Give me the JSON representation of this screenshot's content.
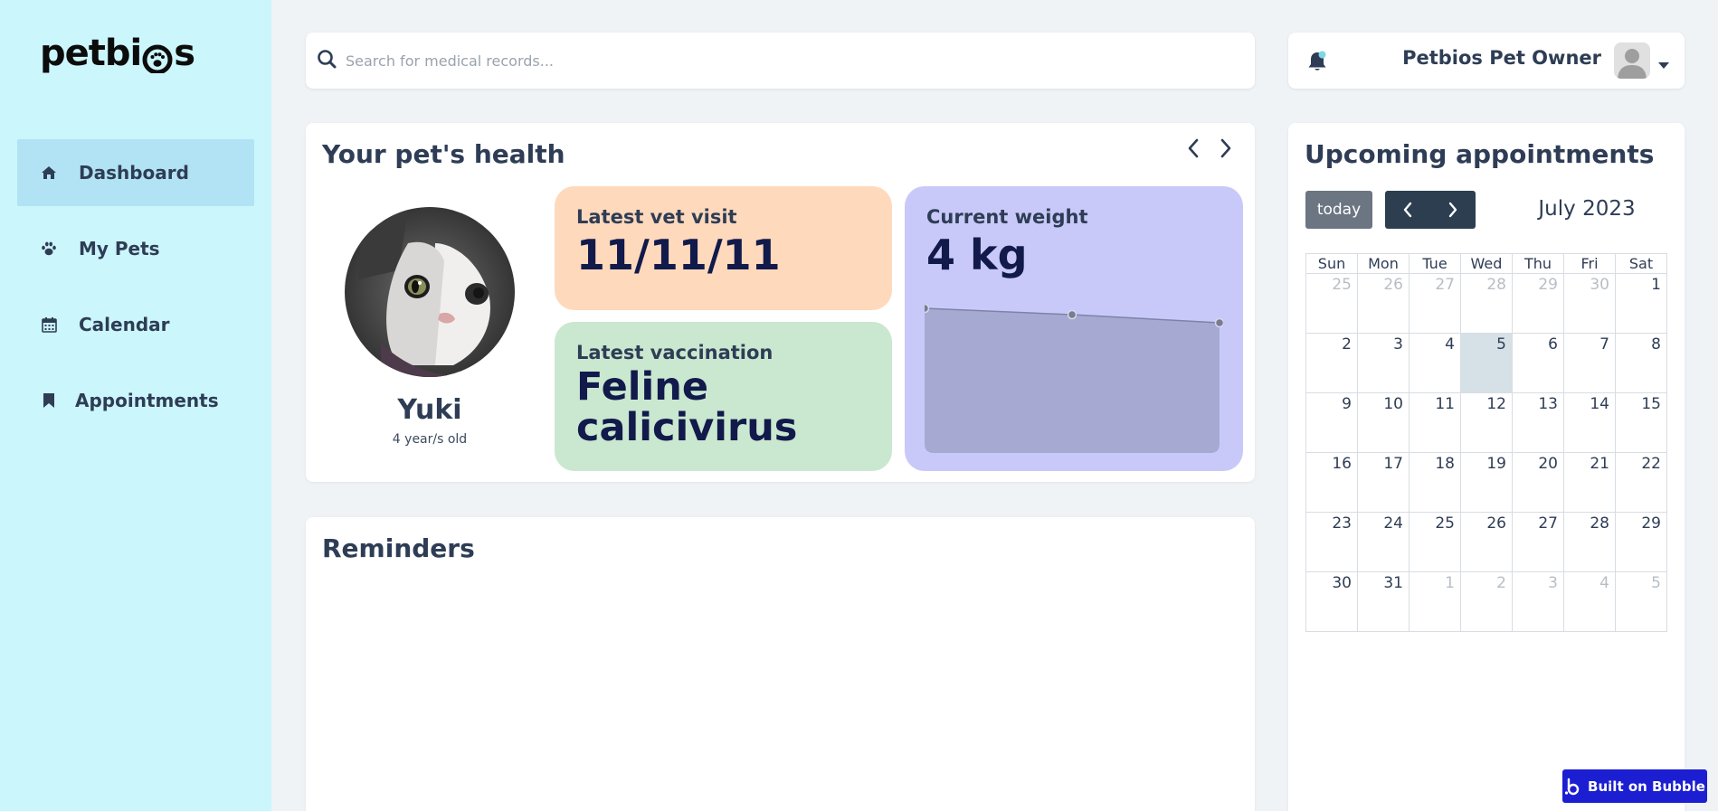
{
  "app": {
    "brand_left": "petbi",
    "brand_right": "s"
  },
  "sidebar": {
    "items": [
      {
        "label": "Dashboard",
        "icon": "home-icon",
        "active": true
      },
      {
        "label": "My Pets",
        "icon": "paw-icon",
        "active": false
      },
      {
        "label": "Calendar",
        "icon": "calendar-icon",
        "active": false
      },
      {
        "label": "Appointments",
        "icon": "bookmark-icon",
        "active": false
      }
    ]
  },
  "search": {
    "placeholder": "Search for medical records...",
    "value": ""
  },
  "user": {
    "name": "Petbios Pet Owner"
  },
  "health": {
    "title": "Your pet's health",
    "pet_name": "Yuki",
    "pet_age": "4 year/s old",
    "visit_label": "Latest vet visit",
    "visit_value": "11/11/11",
    "vaccination_label": "Latest vaccination",
    "vaccination_value": "Feline calicivirus",
    "weight_label": "Current weight",
    "weight_value": "4 kg"
  },
  "reminders": {
    "title": "Reminders"
  },
  "appointments": {
    "title": "Upcoming appointments",
    "today_label": "today",
    "month_label": "July 2023",
    "weekdays": [
      "Sun",
      "Mon",
      "Tue",
      "Wed",
      "Thu",
      "Fri",
      "Sat"
    ],
    "weeks": [
      [
        "25",
        "26",
        "27",
        "28",
        "29",
        "30",
        "1"
      ],
      [
        "2",
        "3",
        "4",
        "5",
        "6",
        "7",
        "8"
      ],
      [
        "9",
        "10",
        "11",
        "12",
        "13",
        "14",
        "15"
      ],
      [
        "16",
        "17",
        "18",
        "19",
        "20",
        "21",
        "22"
      ],
      [
        "23",
        "24",
        "25",
        "26",
        "27",
        "28",
        "29"
      ],
      [
        "30",
        "31",
        "1",
        "2",
        "3",
        "4",
        "5"
      ]
    ]
  },
  "footer": {
    "bubble_label": "Built on Bubble"
  },
  "colors": {
    "sidebar_bg": "#cbf6fc",
    "nav_active": "#b1e3f5",
    "visit_tile": "#fed9bc",
    "vaccination_tile": "#cae7cf",
    "weight_tile": "#c8c9f9",
    "bubble_badge": "#1c1fd1"
  }
}
